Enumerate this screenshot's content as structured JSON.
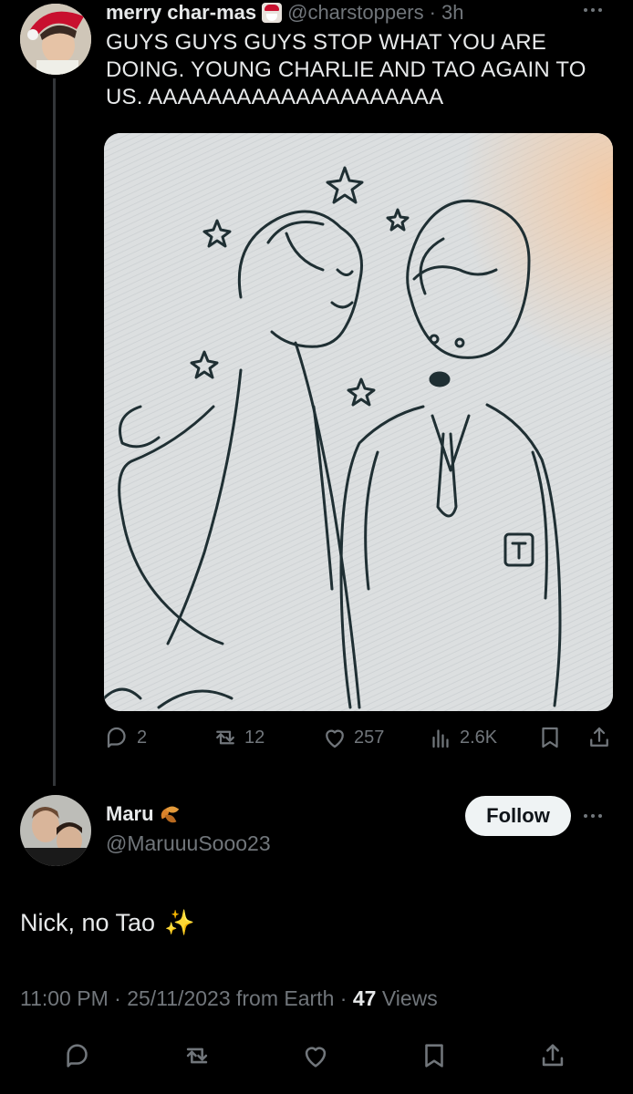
{
  "original_tweet": {
    "display_name": "merry char-mas",
    "name_emoji": "santa-emoji",
    "handle": "@charstoppers",
    "separator": "·",
    "time": "3h",
    "text": "GUYS GUYS GUYS STOP WHAT YOU ARE DOING. YOUNG CHARLIE AND TAO AGAIN TO US. AAAAAAAAAAAAAAAAAAAA",
    "more_icon": "more-horizontal-icon",
    "actions": {
      "replies": "2",
      "retweets": "12",
      "likes": "257",
      "views": "2.6K"
    },
    "media_description_icon": "sketch-illustration"
  },
  "reply": {
    "display_name": "Maru",
    "name_emoji": "leaves-emoji",
    "handle": "@MaruuuSooo23",
    "follow_label": "Follow",
    "text": "Nick, no Tao",
    "text_emoji": "✨",
    "meta": {
      "time": "11:00 PM",
      "dot1": "·",
      "date": "25/11/2023",
      "source": "from Earth",
      "dot2": "·",
      "views_count": "47",
      "views_label": "Views"
    }
  },
  "colors": {
    "background": "#000000",
    "text_primary": "#e7e9ea",
    "text_secondary": "#71767b",
    "divider": "#333639",
    "follow_bg": "#eff3f4"
  }
}
